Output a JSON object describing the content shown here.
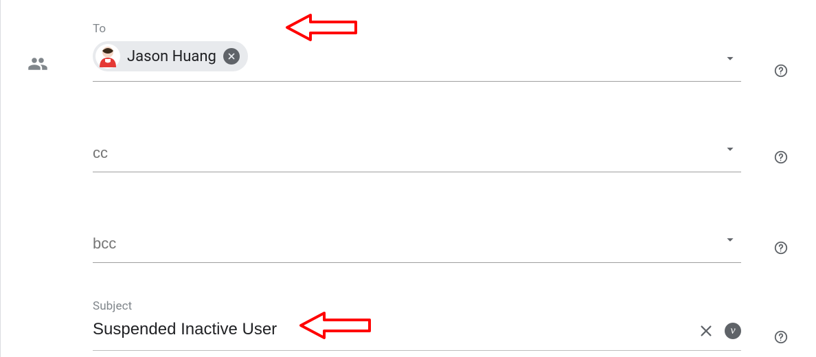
{
  "fields": {
    "to": {
      "label": "To",
      "chip": {
        "name": "Jason Huang"
      }
    },
    "cc": {
      "label": "cc"
    },
    "bcc": {
      "label": "bcc"
    },
    "subject": {
      "label": "Subject",
      "value": "Suspended Inactive User"
    }
  },
  "icons": {
    "variable_glyph": "v"
  },
  "colors": {
    "annotation": "#ff0000",
    "chip_bg": "#e8eaed",
    "muted": "#5f6368"
  }
}
